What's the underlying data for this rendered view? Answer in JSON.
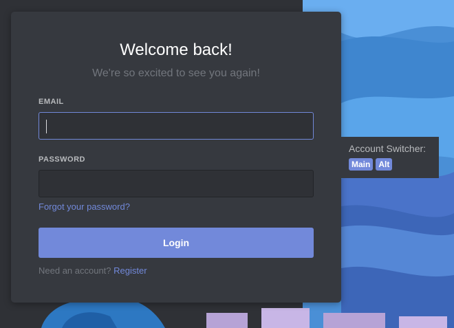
{
  "login": {
    "title": "Welcome back!",
    "subtitle": "We're so excited to see you again!",
    "email_label": "EMAIL",
    "email_value": "",
    "password_label": "PASSWORD",
    "password_value": "",
    "forgot_password": "Forgot your password?",
    "login_button": "Login",
    "need_account": "Need an account?",
    "register": "Register"
  },
  "account_switcher": {
    "label": "Account Switcher:",
    "accounts": [
      "Main",
      "Alt"
    ]
  },
  "colors": {
    "accent": "#7289da",
    "card": "#36393f",
    "input_bg": "#2f3136",
    "background_sky": "#5b9fe6"
  }
}
